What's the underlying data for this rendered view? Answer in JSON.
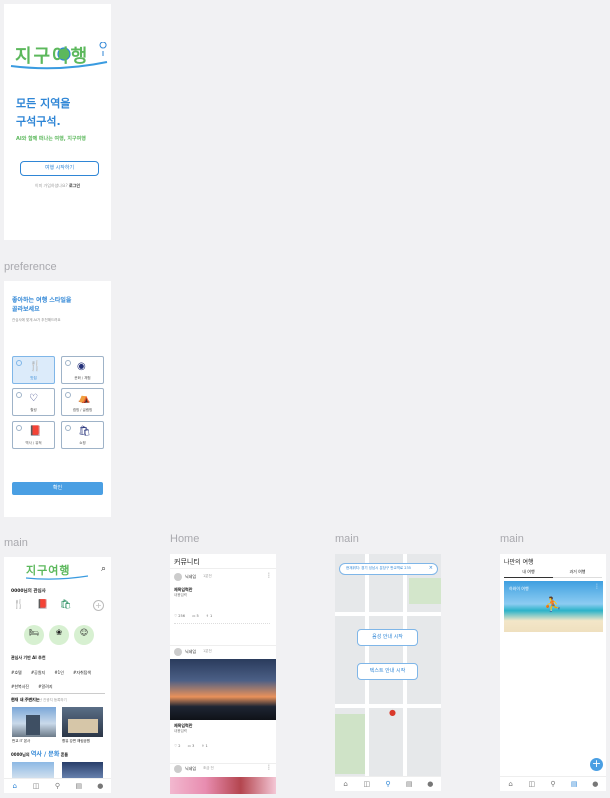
{
  "onboarding": {
    "logo_text": "지구여행",
    "headline_line1": "모든 지역을",
    "headline_line2": "구석구석.",
    "tagline": "AI와 함께 떠나는 여행, 지구여행",
    "start_button": "여행 시작하기",
    "login_prompt": "이미 가입하셨나요?",
    "login_link": "로그인"
  },
  "preference": {
    "section_label": "preference",
    "title_line1": "좋아하는 여행 스타일을",
    "title_line2": "골라보세요",
    "subtitle": "관심사에 맞게 AI가 추천해드려요",
    "options": [
      {
        "label": "맛집",
        "icon": "fork-knife-icon",
        "selected": true
      },
      {
        "label": "문화 / 체험",
        "icon": "mask-icon",
        "selected": false
      },
      {
        "label": "힐링",
        "icon": "heart-icon",
        "selected": false
      },
      {
        "label": "캠핑 / 글램핑",
        "icon": "tent-icon",
        "selected": false
      },
      {
        "label": "역사 / 유적",
        "icon": "book-icon",
        "selected": false
      },
      {
        "label": "쇼핑",
        "icon": "bag-icon",
        "selected": false
      }
    ],
    "confirm_button": "확인"
  },
  "main_home": {
    "section_label": "main",
    "logo_text": "지구여행",
    "greeting": "0000님의 관심사",
    "recommend_title": "관심사 기반 AI 추천",
    "hashtags": [
      "#호텔",
      "#공원지",
      "#1인",
      "#자취탐색",
      "#한복사진",
      "#알려지"
    ],
    "search_text": "최근 방문 부산 관광지 등록하기",
    "nearby_title": "현재 내 주변지는",
    "cards": [
      {
        "caption": "판교 IT 본사"
      },
      {
        "caption": "향유 강변 해림공원"
      }
    ],
    "story_prefix": "0000님의 ",
    "story_highlight": "역사 / 문화",
    "story_suffix": " 흔들"
  },
  "community": {
    "section_label": "Home",
    "title": "커뮤니티",
    "posts": [
      {
        "user": "닉네임",
        "time": "1분전",
        "title": "제목입력란",
        "body": "내용입력",
        "likes": "256",
        "comments": "5",
        "shares": "1"
      },
      {
        "user": "닉네임",
        "time": "1분전",
        "title": "제목입력란",
        "body": "내용입력",
        "likes": "2",
        "comments": "3",
        "shares": "1"
      },
      {
        "user": "닉네임",
        "time": "조금 전",
        "title": "",
        "body": "",
        "likes": "",
        "comments": "",
        "shares": ""
      }
    ]
  },
  "map": {
    "section_label": "main",
    "search_text": "현재위치: 경기 성남시 분당구 판교역로 235",
    "voice_button": "음성 안내 시작",
    "text_button": "텍스트 안내 시작"
  },
  "my_trip": {
    "section_label": "main",
    "title": "나만의 여행",
    "tabs": [
      "내 여행",
      "과거 여행"
    ],
    "card_label": "하와이 여행"
  },
  "colors": {
    "accent": "#2f86d6",
    "accent_light": "#dcebfa",
    "button_blue": "#4a9fe3"
  }
}
